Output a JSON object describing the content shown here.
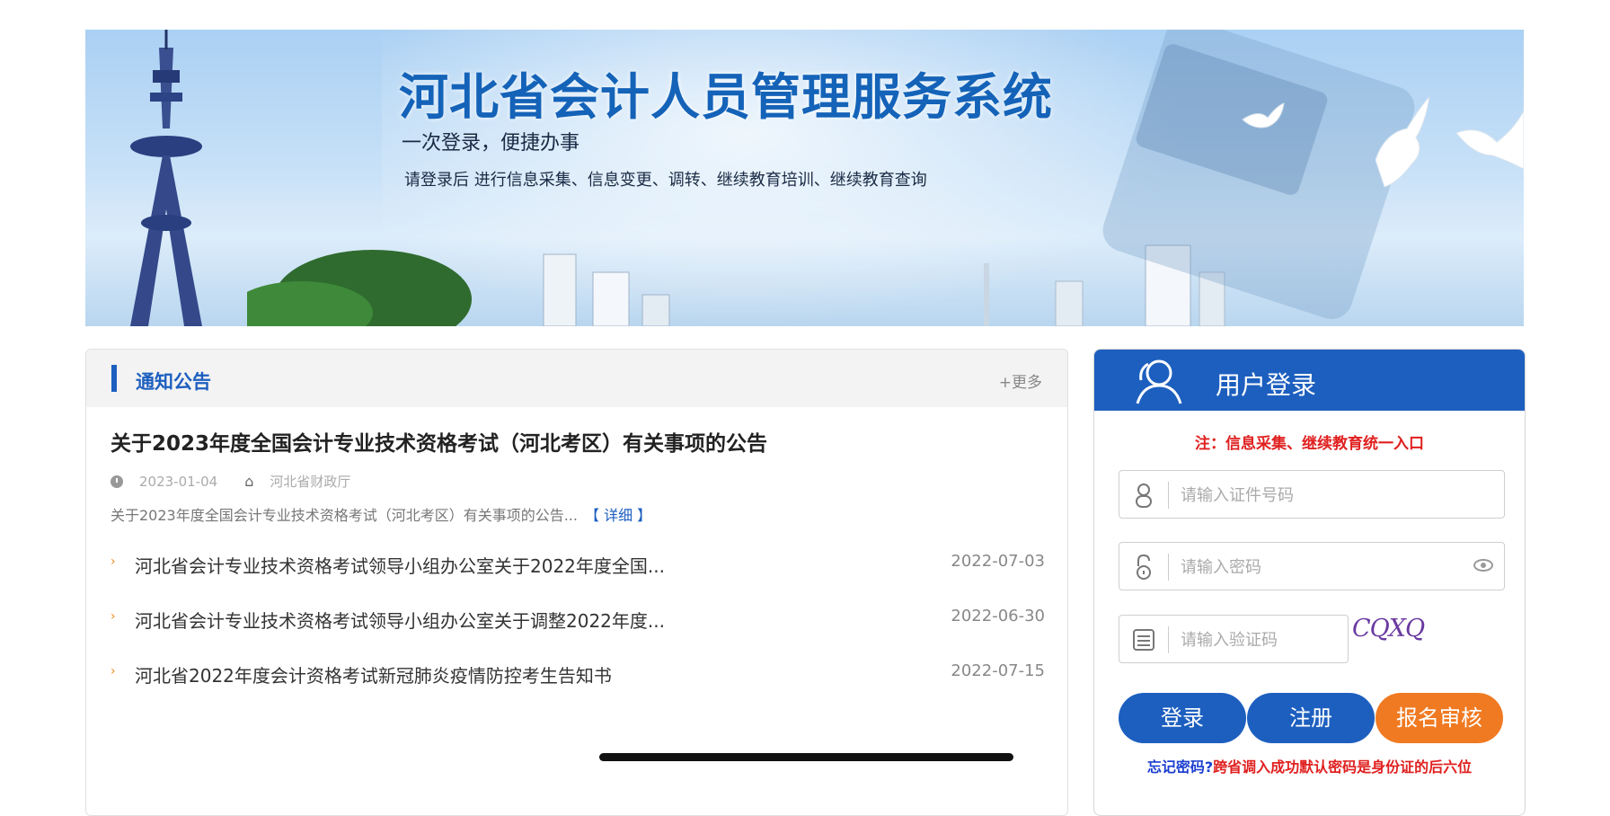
{
  "banner": {
    "title": "河北省会计人员管理服务系统",
    "subtitle": "一次登录，便捷办事",
    "description": "请登录后 进行信息采集、信息变更、调转、继续教育培训、继续教育查询"
  },
  "notice": {
    "title": "通知公告",
    "more": "+更多",
    "featured": {
      "title": "关于2023年度全国会计专业技术资格考试（河北考区）有关事项的公告",
      "date": "2023-01-04",
      "source": "河北省财政厅",
      "summary": "关于2023年度全国会计专业技术资格考试（河北考区）有关事项的公告...",
      "detail": "【 详细 】"
    },
    "items": [
      {
        "text": "河北省会计专业技术资格考试领导小组办公室关于2022年度全国...",
        "date": "2022-07-03"
      },
      {
        "text": "河北省会计专业技术资格考试领导小组办公室关于调整2022年度...",
        "date": "2022-06-30"
      },
      {
        "text": "河北省2022年度会计资格考试新冠肺炎疫情防控考生告知书",
        "date": "2022-07-15"
      }
    ]
  },
  "login": {
    "title": "用户登录",
    "note": "注：信息采集、继续教育统一入口",
    "id_placeholder": "请输入证件号码",
    "password_placeholder": "请输入密码",
    "captcha_placeholder": "请输入验证码",
    "captcha_text": "CQXQ",
    "login_label": "登录",
    "register_label": "注册",
    "review_label": "报名审核",
    "forgot_label": "忘记密码?",
    "forgot_hint": "跨省调入成功默认密码是身份证的后六位"
  },
  "colors": {
    "primary": "#1d5fbf",
    "accent": "#f07a22",
    "alert": "#e02020"
  }
}
